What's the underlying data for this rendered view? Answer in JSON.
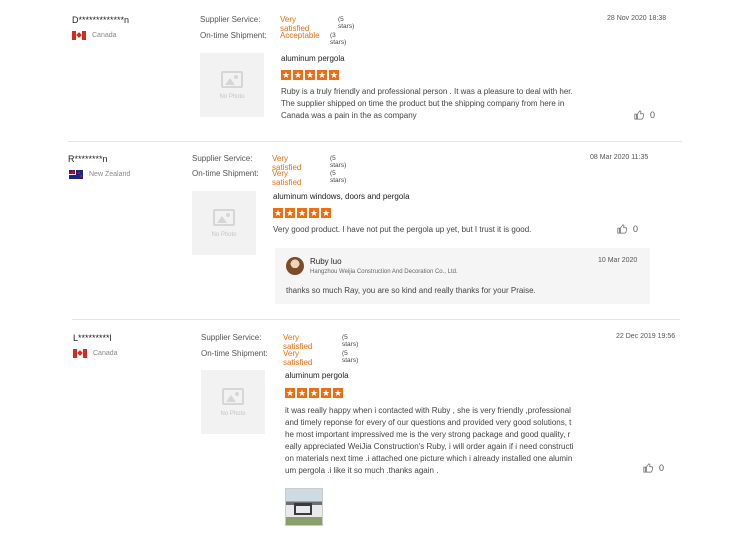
{
  "labels": {
    "supplier_service": "Supplier Service:",
    "ontime_shipment": "On-time Shipment:",
    "no_photo": "No Photo"
  },
  "reviews": [
    {
      "name": "D*************n",
      "country": "Canada",
      "supplier_value": "Very satisfied",
      "supplier_stars": "(5 stars)",
      "shipment_value": "Acceptable",
      "shipment_stars": "(3 stars)",
      "date": "28 Nov 2020 18:38",
      "product": "aluminum pergola",
      "rating": 5,
      "text_lines": [
        "Ruby is a truly friendly and professional person . It was a pleasure to deal with her.",
        "The supplier shipped on time the product but the shipping company from here in",
        "Canada was a pain in the as company"
      ],
      "likes": "0"
    },
    {
      "name": "R********n",
      "country": "New Zealand",
      "supplier_value": "Very satisfied",
      "supplier_stars": "(5 stars)",
      "shipment_value": "Very satisfied",
      "shipment_stars": "(5 stars)",
      "date": "08 Mar 2020 11:35",
      "product": "aluminum windows, doors and pergola",
      "rating": 5,
      "text_lines": [
        "Very good product. I have not put the pergola up yet, but I trust it is good."
      ],
      "likes": "0",
      "reply": {
        "name": "Ruby luo",
        "company": "Hangzhou Weijia Construction And Decoration Co., Ltd.",
        "date": "10 Mar 2020",
        "text": "thanks so much Ray, you are so kind and really thanks for your Praise."
      }
    },
    {
      "name": "L*********l",
      "country": "Canada",
      "supplier_value": "Very satisfied",
      "supplier_stars": "(5 stars)",
      "shipment_value": "Very satisfied",
      "shipment_stars": "(5 stars)",
      "date": "22 Dec 2019 19:56",
      "product": "aluminum pergola",
      "rating": 5,
      "text_lines": [
        "it was really happy when i contacted with Ruby , she is very friendly ,professional",
        "and timely reponse for every of our questions and provided very good solutions, t",
        "he most important impressived me is the very strong package and good quality, r",
        "eally appreciated WeiJia Construction's Ruby, i will order again if i need constructi",
        "on materials next time .i attached one picture which i already installed one alumin",
        "um pergola .i like it so much .thanks again ."
      ],
      "likes": "0"
    }
  ]
}
